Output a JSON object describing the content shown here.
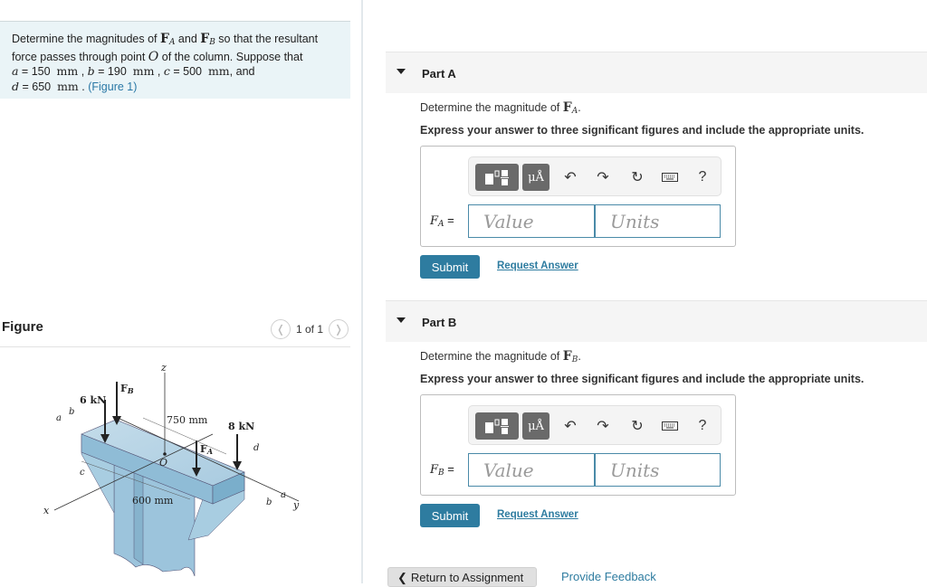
{
  "problem": {
    "line1_pre": "Determine the magnitudes of ",
    "FA_vec": "F",
    "FA_sub": "A",
    "and": " and ",
    "FB_vec": "F",
    "FB_sub": "B",
    "line1_post": " so that the resultant",
    "line2_pre": "force passes through point ",
    "point": "O",
    "line2_post": " of the column. Suppose that",
    "params": [
      {
        "var": "a",
        "value": "150",
        "unit": "mm"
      },
      {
        "var": "b",
        "value": "190",
        "unit": "mm"
      },
      {
        "var": "c",
        "value": "500",
        "unit": "mm"
      },
      {
        "var": "d",
        "value": "650",
        "unit": "mm"
      }
    ],
    "and_word": ", and",
    "figure_link": "(Figure 1)"
  },
  "figure": {
    "title": "Figure",
    "pager_text": "1 of 1",
    "prev_icon": "chevron-left",
    "next_icon": "chevron-right",
    "labels": {
      "z": "z",
      "x": "x",
      "y": "y",
      "O": "O",
      "F_B": "F",
      "F_B_sub": "B",
      "F_A": "F",
      "F_A_sub": "A",
      "six_kN": "6 kN",
      "eight_kN": "8 kN",
      "dim_750": "750 mm",
      "dim_600": "600 mm",
      "a": "a",
      "b": "b",
      "c": "c",
      "d": "d"
    }
  },
  "parts": [
    {
      "title": "Part A",
      "question_pre": "Determine the magnitude of ",
      "vec": "F",
      "vec_sub": "A",
      "question_post": ".",
      "instruction": "Express your answer to three significant figures and include the appropriate units.",
      "label_var": "F",
      "label_sub": "A",
      "label_eq": " =",
      "value_placeholder": "Value",
      "units_placeholder": "Units",
      "submit": "Submit",
      "request": "Request Answer"
    },
    {
      "title": "Part B",
      "question_pre": "Determine the magnitude of ",
      "vec": "F",
      "vec_sub": "B",
      "question_post": ".",
      "instruction": "Express your answer to three significant figures and include the appropriate units.",
      "label_var": "F",
      "label_sub": "B",
      "label_eq": " =",
      "value_placeholder": "Value",
      "units_placeholder": "Units",
      "submit": "Submit",
      "request": "Request Answer"
    }
  ],
  "toolbar": {
    "templates_icon": "templates-icon",
    "units_label": "μÅ",
    "undo": "↶",
    "redo": "↷",
    "reset": "↻",
    "help": "?"
  },
  "footer": {
    "return_icon": "❮",
    "return_label": "Return to Assignment",
    "feedback_label": "Provide Feedback"
  }
}
